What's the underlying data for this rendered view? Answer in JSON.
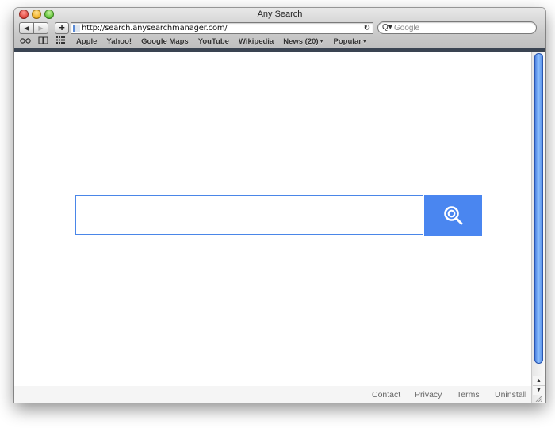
{
  "window": {
    "title": "Any Search"
  },
  "toolbar": {
    "back_label": "◀",
    "forward_label": "▶",
    "add_label": "+",
    "url": "http://search.anysearchmanager.com/",
    "reload_icon": "↻",
    "search_placeholder": "Google",
    "search_icon": "Q▾"
  },
  "bookmarks": {
    "icons": [
      "reading-list-icon",
      "bookmarks-book-icon",
      "top-sites-grid-icon"
    ],
    "items": [
      {
        "label": "Apple"
      },
      {
        "label": "Yahoo!"
      },
      {
        "label": "Google Maps"
      },
      {
        "label": "YouTube"
      },
      {
        "label": "Wikipedia"
      },
      {
        "label": "News (20)",
        "dropdown": true
      },
      {
        "label": "Popular",
        "dropdown": true
      }
    ],
    "dropdown_arrow": "▼"
  },
  "main": {
    "search_value": "",
    "search_placeholder": "",
    "search_button_color": "#4a86f0",
    "search_border_color": "#4a86e8"
  },
  "footer": {
    "links": [
      {
        "label": "Contact"
      },
      {
        "label": "Privacy"
      },
      {
        "label": "Terms"
      },
      {
        "label": "Uninstall"
      }
    ]
  },
  "scrollbar": {
    "up_label": "▲",
    "down_label": "▼"
  }
}
